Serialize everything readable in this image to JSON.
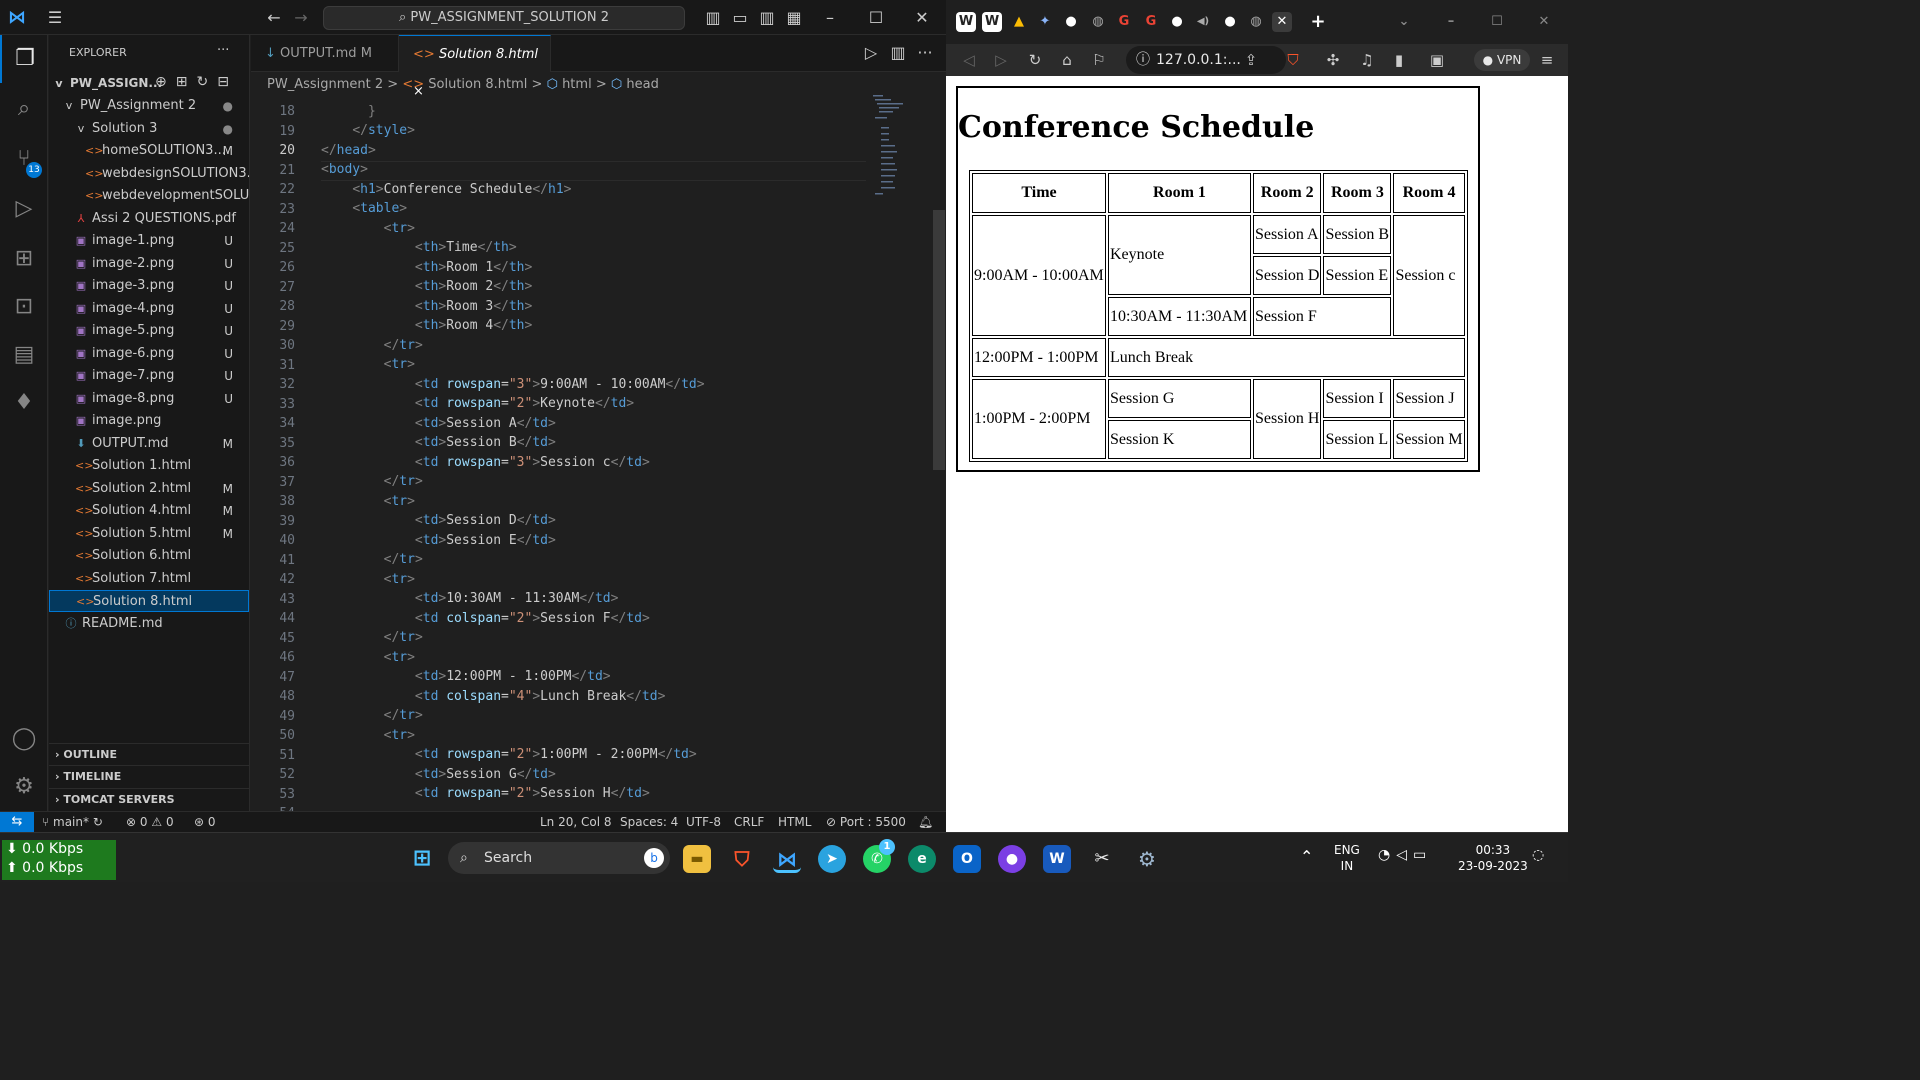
{
  "vscode": {
    "command_center": "PW_ASSIGNMENT_SOLUTION 2",
    "explorer": {
      "header": "EXPLORER",
      "root": "PW_ASSIGN...",
      "items": [
        {
          "label": "PW_Assignment 2",
          "status": "●",
          "icon": "v"
        },
        {
          "label": "Solution 3",
          "status": "●",
          "icon": "v"
        },
        {
          "label": "homeSOLUTION3....",
          "status": "M",
          "icon": "<>"
        },
        {
          "label": "webdesignSOLUTION3....",
          "status": "",
          "icon": "<>"
        },
        {
          "label": "webdevelopmentSOLU...",
          "status": "",
          "icon": "<>"
        },
        {
          "label": "Assi 2 QUESTIONS.pdf",
          "status": "",
          "icon": "pdf"
        },
        {
          "label": "image-1.png",
          "status": "U",
          "icon": "img"
        },
        {
          "label": "image-2.png",
          "status": "U",
          "icon": "img"
        },
        {
          "label": "image-3.png",
          "status": "U",
          "icon": "img"
        },
        {
          "label": "image-4.png",
          "status": "U",
          "icon": "img"
        },
        {
          "label": "image-5.png",
          "status": "U",
          "icon": "img"
        },
        {
          "label": "image-6.png",
          "status": "U",
          "icon": "img"
        },
        {
          "label": "image-7.png",
          "status": "U",
          "icon": "img"
        },
        {
          "label": "image-8.png",
          "status": "U",
          "icon": "img"
        },
        {
          "label": "image.png",
          "status": "",
          "icon": "img"
        },
        {
          "label": "OUTPUT.md",
          "status": "M",
          "icon": "md"
        },
        {
          "label": "Solution 1.html",
          "status": "",
          "icon": "<>"
        },
        {
          "label": "Solution 2.html",
          "status": "M",
          "icon": "<>"
        },
        {
          "label": "Solution 4.html",
          "status": "M",
          "icon": "<>"
        },
        {
          "label": "Solution 5.html",
          "status": "M",
          "icon": "<>"
        },
        {
          "label": "Solution 6.html",
          "status": "",
          "icon": "<>"
        },
        {
          "label": "Solution 7.html",
          "status": "",
          "icon": "<>"
        },
        {
          "label": "Solution 8.html",
          "status": "",
          "icon": "<>"
        },
        {
          "label": "README.md",
          "status": "",
          "icon": "i"
        }
      ],
      "sections": [
        "OUTLINE",
        "TIMELINE",
        "TOMCAT SERVERS"
      ]
    },
    "source_control_badge": "13",
    "tabs": [
      {
        "label": "OUTPUT.md",
        "status": "M"
      },
      {
        "label": "Solution 8.html",
        "status": "×"
      }
    ],
    "breadcrumb": [
      "PW_Assignment 2",
      ">",
      "Solution 8.html",
      ">",
      "html",
      ">",
      "head"
    ],
    "line_numbers": [
      "18",
      "19",
      "20",
      "21",
      "22",
      "23",
      "24",
      "25",
      "26",
      "27",
      "28",
      "29",
      "30",
      "31",
      "32",
      "33",
      "34",
      "35",
      "36",
      "37",
      "38",
      "39",
      "40",
      "41",
      "42",
      "43",
      "44",
      "45",
      "46",
      "47",
      "48",
      "49",
      "50",
      "51",
      "52",
      "53",
      "54"
    ],
    "status": {
      "branch": "main*",
      "errors": "0",
      "warnings": "0",
      "ports": "0",
      "position": "Ln 20, Col 8",
      "spaces": "Spaces: 4",
      "encoding": "UTF-8",
      "eol": "CRLF",
      "lang": "HTML",
      "port": "Port : 5500"
    }
  },
  "browser": {
    "url": "127.0.0.1:...",
    "vpn": "VPN",
    "page_title": "Conference Schedule",
    "headers": [
      "Time",
      "Room 1",
      "Room 2",
      "Room 3",
      "Room 4"
    ],
    "cells": {
      "t1": "9:00AM - 10:00AM",
      "keynote": "Keynote",
      "sa": "Session A",
      "sb": "Session B",
      "sc": "Session c",
      "sd": "Session D",
      "se": "Session E",
      "t2": "10:30AM - 11:30AM",
      "sf": "Session F",
      "t3": "12:00PM - 1:00PM",
      "lunch": "Lunch Break",
      "t4": "1:00PM - 2:00PM",
      "sg": "Session G",
      "sh": "Session H",
      "si": "Session I",
      "sj": "Session J",
      "sk": "Session K",
      "sl": "Session L",
      "sm": "Session M"
    }
  },
  "taskbar": {
    "net_down": "⬇ 0.0 Kbps",
    "net_up": "⬆ 0.0 Kbps",
    "search": "Search",
    "lang": "ENG",
    "region": "IN",
    "time": "00:33",
    "date": "23-09-2023",
    "whatsapp_badge": "1"
  }
}
